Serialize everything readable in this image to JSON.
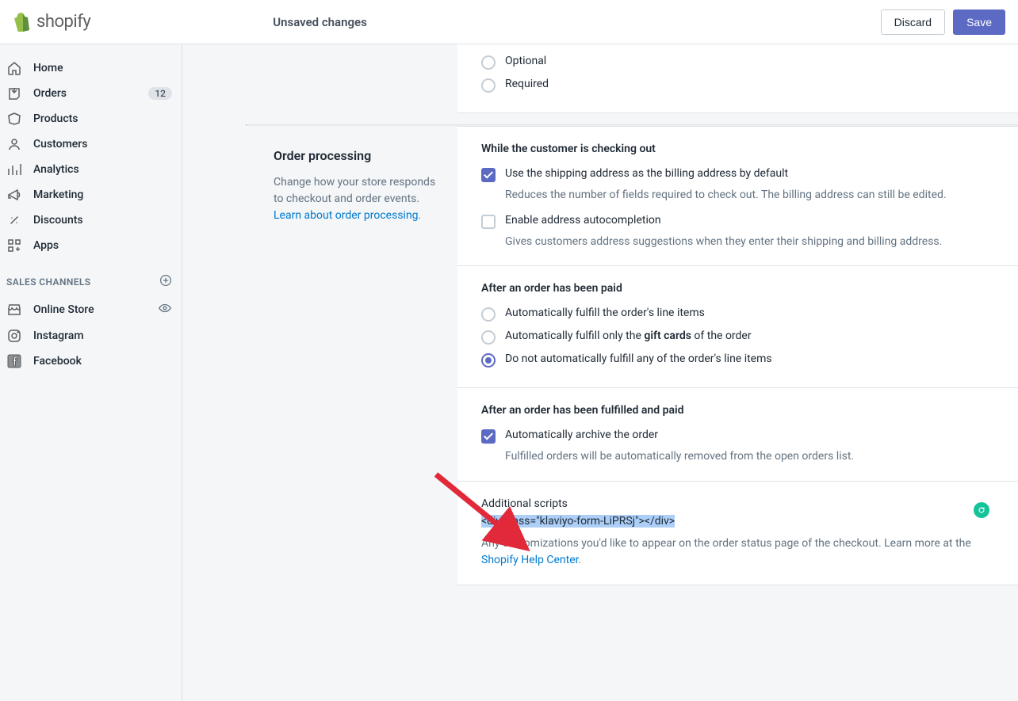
{
  "topbar": {
    "title": "Unsaved changes",
    "discard": "Discard",
    "save": "Save"
  },
  "sidebar": {
    "items": [
      {
        "label": "Home"
      },
      {
        "label": "Orders",
        "badge": "12"
      },
      {
        "label": "Products"
      },
      {
        "label": "Customers"
      },
      {
        "label": "Analytics"
      },
      {
        "label": "Marketing"
      },
      {
        "label": "Discounts"
      },
      {
        "label": "Apps"
      }
    ],
    "sales_channels_header": "SALES CHANNELS",
    "channels": [
      {
        "label": "Online Store"
      },
      {
        "label": "Instagram"
      },
      {
        "label": "Facebook"
      }
    ]
  },
  "top_card": {
    "radios": {
      "optional": "Optional",
      "required": "Required"
    }
  },
  "order_processing": {
    "title": "Order processing",
    "desc_1": "Change how your store responds to checkout and order events. ",
    "link": "Learn about order processing",
    "period": ".",
    "while_checkout": {
      "heading": "While the customer is checking out",
      "use_shipping": {
        "label": "Use the shipping address as the billing address by default",
        "hint": "Reduces the number of fields required to check out. The billing address can still be edited."
      },
      "autocomplete": {
        "label": "Enable address autocompletion",
        "hint": "Gives customers address suggestions when they enter their shipping and billing address."
      }
    },
    "after_paid": {
      "heading": "After an order has been paid",
      "opt1": "Automatically fulfill the order's line items",
      "opt2_pre": "Automatically fulfill only the ",
      "opt2_bold": "gift cards",
      "opt2_post": " of the order",
      "opt3": "Do not automatically fulfill any of the order's line items"
    },
    "after_fulfilled": {
      "heading": "After an order has been fulfilled and paid",
      "archive": {
        "label": "Automatically archive the order",
        "hint": "Fulfilled orders will be automatically removed from the open orders list."
      }
    },
    "scripts": {
      "label": "Additional scripts",
      "value": "<div class=\"klaviyo-form-LiPRSj\"></div>",
      "hint_1": "Any customizations you'd like to appear on the order status page of the checkout. Learn more at the ",
      "hint_link": "Shopify Help Center",
      "period2": "."
    }
  }
}
